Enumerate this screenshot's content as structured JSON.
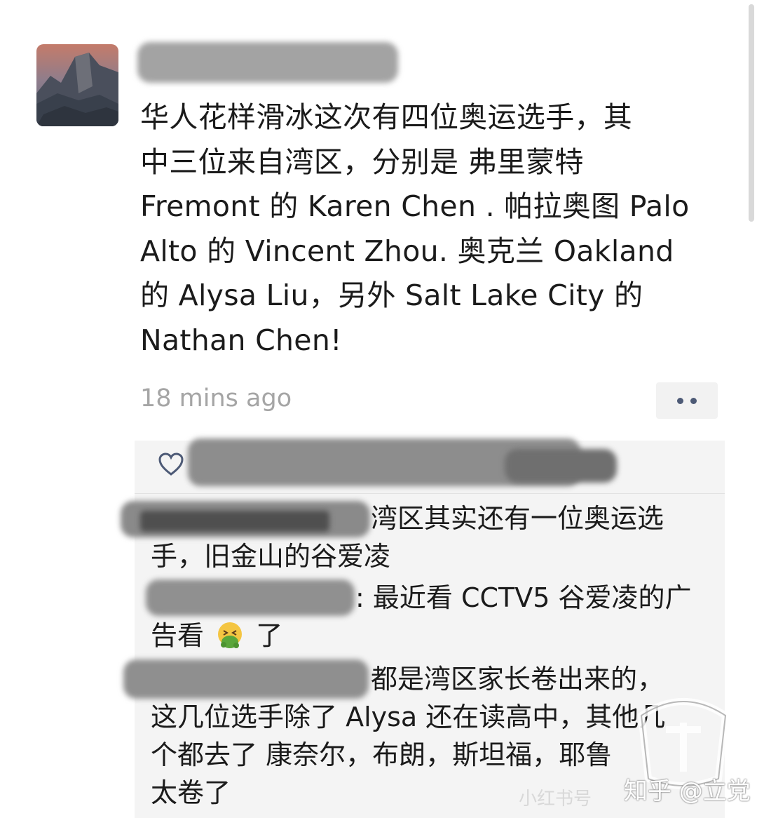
{
  "post": {
    "text_lines": [
      "华人花样滑冰这次有四位奥运选手，其",
      "中三位来自湾区，分别是 弗里蒙特",
      "Fremont 的 Karen Chen . 帕拉奥图 Palo",
      "Alto 的 Vincent Zhou.  奥克兰 Oakland",
      "的 Alysa Liu，另外 Salt Lake City 的",
      "Nathan Chen!"
    ],
    "timestamp": "18 mins ago"
  },
  "comments": [
    {
      "lines": [
        "湾区其实还有一位奥运选",
        "手，旧金山的谷爱凌"
      ]
    },
    {
      "lines": [
        ": 最近看 CCTV5 谷爱凌的广",
        "告看",
        "了"
      ]
    },
    {
      "lines": [
        "都是湾区家长卷出来的，",
        "这几位选手除了 Alysa 还在读高中，其他几",
        "个都去了 康奈尔，布朗，斯坦福，耶鲁",
        "太卷了"
      ]
    }
  ],
  "watermark": {
    "zhihu": "知乎 @立党",
    "faint": "小红书号"
  },
  "icons": {
    "heart": "heart-icon",
    "more": "more-dots-icon",
    "emoji": "vomiting-face-emoji"
  },
  "colors": {
    "timestamp": "#a5a5a5",
    "dots": "#4d5a76",
    "comment_bg": "#f4f4f4"
  }
}
